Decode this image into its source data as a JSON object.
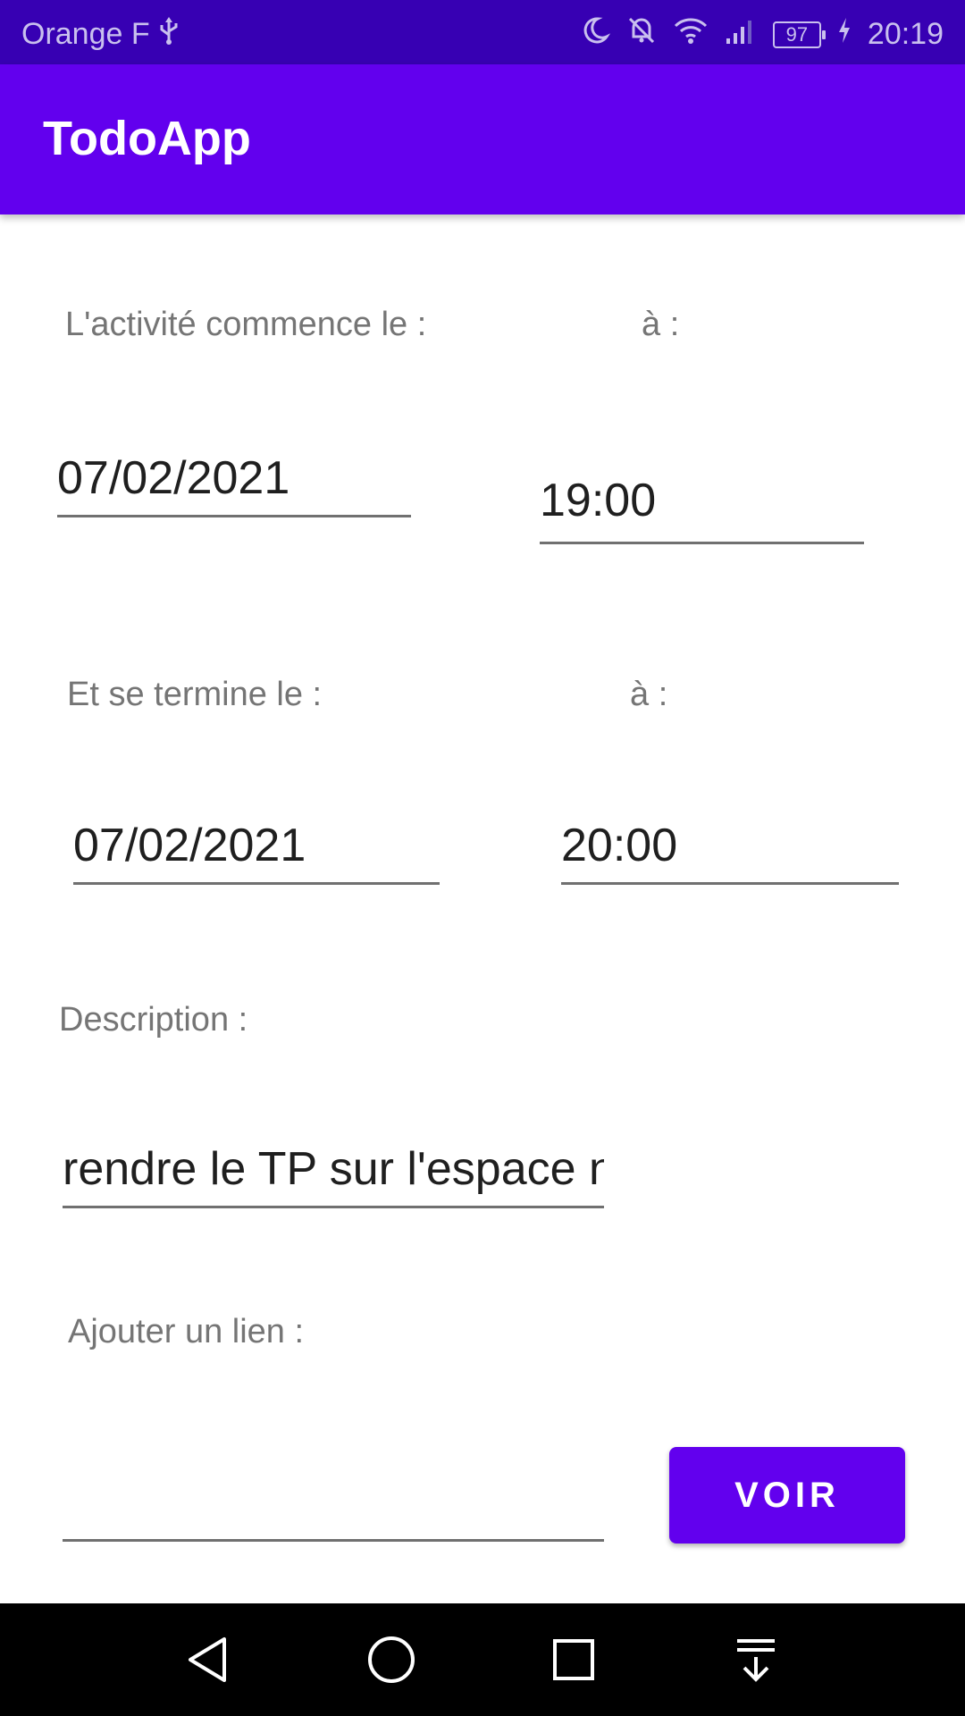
{
  "status_bar": {
    "carrier": "Orange F",
    "battery": "97",
    "time": "20:19"
  },
  "app_bar": {
    "title": "TodoApp"
  },
  "form": {
    "start_date_label": "L'activité commence le :",
    "start_time_label": "à :",
    "start_date_value": "07/02/2021",
    "start_time_value": "19:00",
    "end_date_label": "Et se termine le :",
    "end_time_label": "à :",
    "end_date_value": "07/02/2021",
    "end_time_value": "20:00",
    "description_label": "Description :",
    "description_value": "rendre le TP sur l'espace n",
    "link_label": "Ajouter un lien :",
    "link_value": "",
    "voir_button_label": "VOIR"
  },
  "icons": {
    "usb": "usb-icon",
    "moon": "moon-icon",
    "mute": "mute-icon",
    "wifi": "wifi-icon",
    "signal": "signal-icon",
    "charging": "charging-icon",
    "back": "back-icon",
    "home": "home-icon",
    "recents": "recents-icon",
    "notifications": "notifications-icon"
  },
  "colors": {
    "status_bar": "#3700b3",
    "app_bar": "#6200ee",
    "button": "#6200ee",
    "label_text": "#757575",
    "field_text": "#1f1f1f"
  }
}
